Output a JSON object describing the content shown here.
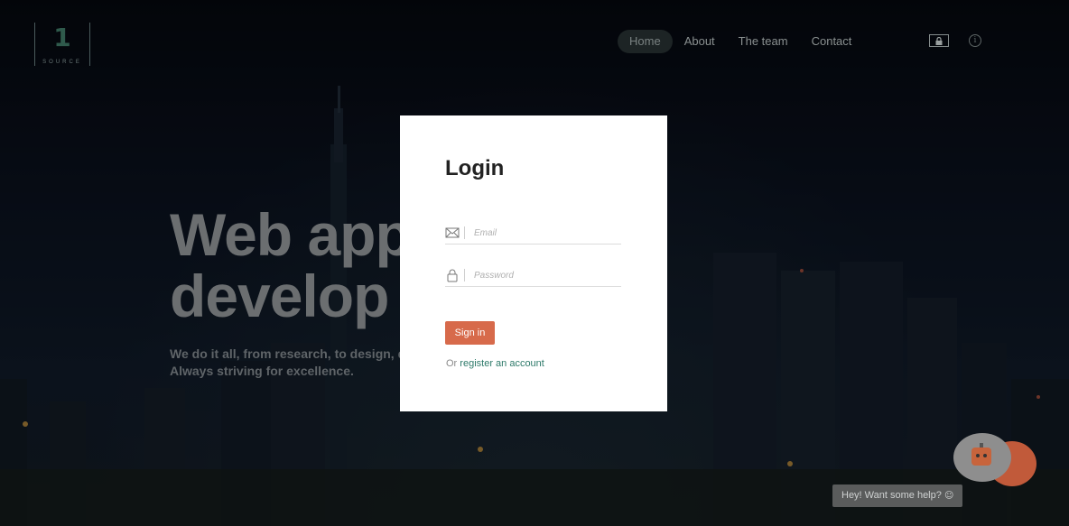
{
  "header": {
    "logo": {
      "number": "1",
      "word": "SOURCE"
    },
    "nav": [
      {
        "label": "Home",
        "active": true
      },
      {
        "label": "About",
        "active": false
      },
      {
        "label": "The team",
        "active": false
      },
      {
        "label": "Contact",
        "active": false
      }
    ],
    "icons": {
      "lock": "lock-icon",
      "info": "info-icon"
    }
  },
  "hero": {
    "title": "Web app\ndevelop",
    "subtitle": "We do it all, from research, to design, d\nAlways striving for excellence."
  },
  "login": {
    "title": "Login",
    "email_placeholder": "Email",
    "password_placeholder": "Password",
    "email_icon": "envelope-icon",
    "password_icon": "padlock-icon",
    "signin_label": "Sign in",
    "or_text": "Or",
    "register_label": "register an account",
    "accent": "#d76a4b",
    "link_color": "#2e7a6a"
  },
  "chat": {
    "bubble_text": "Hey! Want some help?",
    "bubble_icon": "smiley-icon",
    "robot_icon": "robot-icon"
  }
}
